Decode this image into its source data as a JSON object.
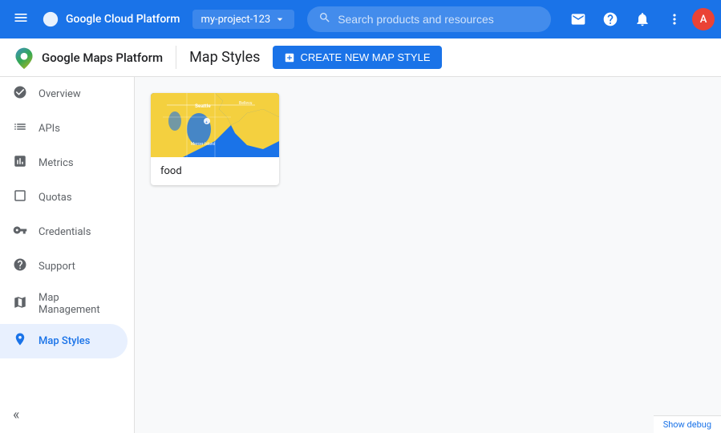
{
  "topbar": {
    "app_name": "Google Cloud Platform",
    "menu_icon": "☰",
    "project_name": "my-project-123",
    "search_placeholder": "Search products and resources",
    "avatar_letter": "A"
  },
  "second_header": {
    "app_name": "Google Maps Platform",
    "page_heading": "Map Styles",
    "create_btn_label": "CREATE NEW MAP STYLE"
  },
  "sidebar": {
    "items": [
      {
        "label": "Overview",
        "icon": "⊙",
        "active": false
      },
      {
        "label": "APIs",
        "icon": "≡",
        "active": false
      },
      {
        "label": "Metrics",
        "icon": "📊",
        "active": false
      },
      {
        "label": "Quotas",
        "icon": "□",
        "active": false
      },
      {
        "label": "Credentials",
        "icon": "🔑",
        "active": false
      },
      {
        "label": "Support",
        "icon": "👤",
        "active": false
      },
      {
        "label": "Map Management",
        "icon": "▦",
        "active": false
      },
      {
        "label": "Map Styles",
        "icon": "◎",
        "active": true
      }
    ],
    "collapse_icon": "«"
  },
  "content": {
    "map_style_card": {
      "label": "food"
    }
  },
  "debug_bar": {
    "label": "Show debug"
  }
}
